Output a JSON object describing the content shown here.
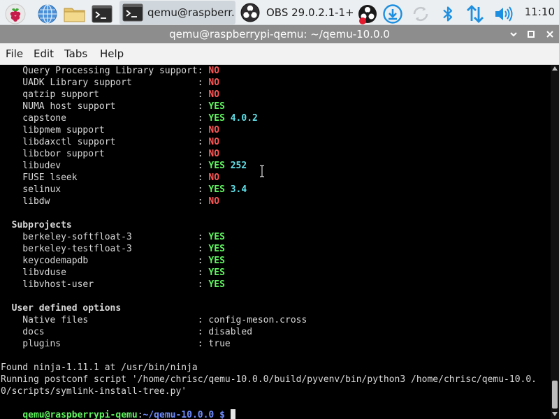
{
  "taskbar": {
    "apps": [
      {
        "icon": "raspberry-pi-menu-icon"
      },
      {
        "icon": "web-browser-icon"
      },
      {
        "icon": "file-manager-icon"
      },
      {
        "icon": "terminal-launcher-icon"
      }
    ],
    "tasks": [
      {
        "icon": "terminal-icon",
        "label": "qemu@raspberr..",
        "active": true
      },
      {
        "icon": "obs-icon",
        "label": "OBS 29.0.2.1-1+..",
        "active": false
      }
    ],
    "tray": [
      {
        "icon": "obs-recording-tray-icon"
      },
      {
        "icon": "updates-download-icon"
      },
      {
        "icon": "sync-icon"
      },
      {
        "icon": "bluetooth-icon"
      },
      {
        "icon": "network-transfer-icon"
      },
      {
        "icon": "volume-icon"
      }
    ],
    "clock": "11:10"
  },
  "window": {
    "title": "qemu@raspberrypi-qemu: ~/qemu-10.0.0",
    "buttons": [
      "minimize-icon",
      "maximize-icon",
      "close-icon"
    ]
  },
  "menu": [
    "File",
    "Edit",
    "Tabs",
    "Help"
  ],
  "terminal": {
    "lines": [
      {
        "segs": [
          {
            "t": "    Query Processing Library support: "
          },
          {
            "t": "NO",
            "c": "no"
          }
        ]
      },
      {
        "segs": [
          {
            "t": "    UADK Library support            : "
          },
          {
            "t": "NO",
            "c": "no"
          }
        ]
      },
      {
        "segs": [
          {
            "t": "    qatzip support                  : "
          },
          {
            "t": "NO",
            "c": "no"
          }
        ]
      },
      {
        "segs": [
          {
            "t": "    NUMA host support               : "
          },
          {
            "t": "YES",
            "c": "yes"
          }
        ]
      },
      {
        "segs": [
          {
            "t": "    capstone                        : "
          },
          {
            "t": "YES",
            "c": "yes"
          },
          {
            "t": " "
          },
          {
            "t": "4.0.2",
            "c": "ver"
          }
        ]
      },
      {
        "segs": [
          {
            "t": "    libpmem support                 : "
          },
          {
            "t": "NO",
            "c": "no"
          }
        ]
      },
      {
        "segs": [
          {
            "t": "    libdaxctl support               : "
          },
          {
            "t": "NO",
            "c": "no"
          }
        ]
      },
      {
        "segs": [
          {
            "t": "    libcbor support                 : "
          },
          {
            "t": "NO",
            "c": "no"
          }
        ]
      },
      {
        "segs": [
          {
            "t": "    libudev                         : "
          },
          {
            "t": "YES",
            "c": "yes"
          },
          {
            "t": " "
          },
          {
            "t": "252",
            "c": "ver"
          }
        ]
      },
      {
        "segs": [
          {
            "t": "    FUSE lseek                      : "
          },
          {
            "t": "NO",
            "c": "no"
          }
        ]
      },
      {
        "segs": [
          {
            "t": "    selinux                         : "
          },
          {
            "t": "YES",
            "c": "yes"
          },
          {
            "t": " "
          },
          {
            "t": "3.4",
            "c": "ver"
          }
        ]
      },
      {
        "segs": [
          {
            "t": "    libdw                           : "
          },
          {
            "t": "NO",
            "c": "no"
          }
        ]
      },
      {
        "segs": []
      },
      {
        "segs": [
          {
            "t": "  Subprojects",
            "c": "bold"
          }
        ]
      },
      {
        "segs": [
          {
            "t": "    berkeley-softfloat-3            : "
          },
          {
            "t": "YES",
            "c": "yes"
          }
        ]
      },
      {
        "segs": [
          {
            "t": "    berkeley-testfloat-3            : "
          },
          {
            "t": "YES",
            "c": "yes"
          }
        ]
      },
      {
        "segs": [
          {
            "t": "    keycodemapdb                    : "
          },
          {
            "t": "YES",
            "c": "yes"
          }
        ]
      },
      {
        "segs": [
          {
            "t": "    libvduse                        : "
          },
          {
            "t": "YES",
            "c": "yes"
          }
        ]
      },
      {
        "segs": [
          {
            "t": "    libvhost-user                   : "
          },
          {
            "t": "YES",
            "c": "yes"
          }
        ]
      },
      {
        "segs": []
      },
      {
        "segs": [
          {
            "t": "  User defined options",
            "c": "bold"
          }
        ]
      },
      {
        "segs": [
          {
            "t": "    Native files                    : config-meson.cross"
          }
        ]
      },
      {
        "segs": [
          {
            "t": "    docs                            : disabled"
          }
        ]
      },
      {
        "segs": [
          {
            "t": "    plugins                         : true"
          }
        ]
      },
      {
        "segs": []
      },
      {
        "segs": [
          {
            "t": "Found ninja-1.11.1 at /usr/bin/ninja"
          }
        ]
      },
      {
        "segs": [
          {
            "t": "Running postconf script '/home/chrisc/qemu-10.0.0/build/pyvenv/bin/python3 /home/chrisc/qemu-10.0."
          }
        ]
      },
      {
        "segs": [
          {
            "t": "0/scripts/symlink-install-tree.py'"
          }
        ]
      }
    ],
    "prompt": {
      "user": "qemu@raspberrypi-qemu",
      "sep": ":",
      "path": "~/qemu-10.0.0",
      "dollar": " $ "
    }
  }
}
